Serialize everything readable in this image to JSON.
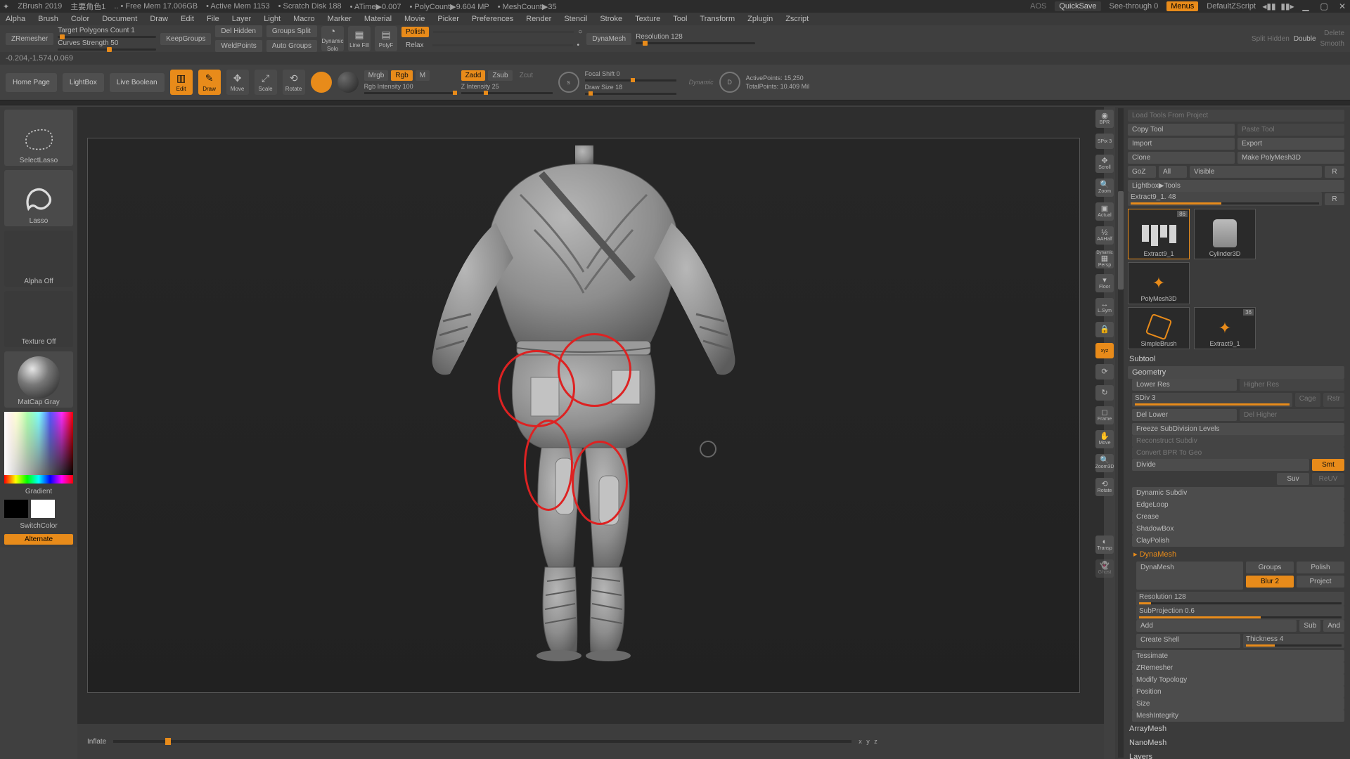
{
  "title_bar": {
    "app": "ZBrush 2019",
    "doc": "主要角色1",
    "free_mem": ".. • Free Mem 17.006GB",
    "active_mem": "• Active Mem 1153",
    "scratch": "• Scratch Disk 188",
    "atime": "• ATime▶0.007",
    "polycount": "• PolyCount▶9.604 MP",
    "meshcount": "• MeshCount▶35",
    "quicksave": "QuickSave",
    "seethrough": "See-through  0",
    "menus": "Menus",
    "defscript": "DefaultZScript",
    "aos": "AOS"
  },
  "menu": [
    "Alpha",
    "Brush",
    "Color",
    "Document",
    "Draw",
    "Edit",
    "File",
    "Layer",
    "Light",
    "Macro",
    "Marker",
    "Material",
    "Movie",
    "Picker",
    "Preferences",
    "Render",
    "Stencil",
    "Stroke",
    "Texture",
    "Tool",
    "Transform",
    "Zplugin",
    "Zscript"
  ],
  "secondary": {
    "zremesher": "ZRemesher",
    "tgt_poly": "Target Polygons Count 1",
    "curve_str": "Curves Strength 50",
    "keepgroups": "KeepGroups",
    "delhidden": "Del Hidden",
    "groupssplit": "Groups Split",
    "weldpoints": "WeldPoints",
    "autogroups": "Auto Groups",
    "dynamic": "Dynamic",
    "solo": "Solo",
    "linefill": "Line Fill",
    "polyf": "PolyF",
    "polish": "Polish",
    "relax": "Relax",
    "dynamesh": "DynaMesh",
    "resolution": "Resolution 128",
    "splithidden": "Split Hidden",
    "double": "Double",
    "delete": "Delete",
    "smooth": "Smooth"
  },
  "coord": "-0.204,-1.574,0.069",
  "ribbon": {
    "home": "Home Page",
    "lightbox": "LightBox",
    "livebool": "Live Boolean",
    "edit": "Edit",
    "draw": "Draw",
    "move": "Move",
    "scale": "Scale",
    "rotate": "Rotate",
    "mrgb": "Mrgb",
    "rgb": "Rgb",
    "m": "M",
    "rgb_int": "Rgb Intensity 100",
    "zadd": "Zadd",
    "zsub": "Zsub",
    "zcut": "Zcut",
    "z_int": "Z Intensity 25",
    "focal": "Focal Shift 0",
    "drawsize": "Draw Size 18",
    "dynamic_l": "Dynamic",
    "active_pts": "ActivePoints: 15,250",
    "total_pts": "TotalPoints: 10.409 Mil"
  },
  "left": {
    "selectlasso": "SelectLasso",
    "lasso": "Lasso",
    "alpha": "Alpha Off",
    "texture": "Texture Off",
    "matcap": "MatCap Gray",
    "gradient": "Gradient",
    "switchcolor": "SwitchColor",
    "alternate": "Alternate"
  },
  "bottom": {
    "inflate": "Inflate",
    "xyz": "x y z"
  },
  "right_strip": {
    "bpr": "BPR",
    "spix": "SPix 3",
    "scroll": "Scroll",
    "zoom": "Zoom",
    "actual": "Actual",
    "aahalf": "AAHalf",
    "persp": "Persp",
    "floor": "Floor",
    "lsym": "L.Sym",
    "lock": "🔒",
    "xyz": "xyz",
    "axis1": "⟳",
    "axis2": "↻",
    "frame": "Frame",
    "move": "Move",
    "zoom3d": "Zoom3D",
    "rotate": "Rotate",
    "transp": "Transp",
    "ghost": "Ghost",
    "dynamic": "Dynamic"
  },
  "right_panel": {
    "load_tools": "Load Tools From Project",
    "copytool": "Copy Tool",
    "pastetool": "Paste Tool",
    "import": "Import",
    "export": "Export",
    "clone": "Clone",
    "makepoly": "Make PolyMesh3D",
    "goz": "GoZ",
    "all": "All",
    "visible": "Visible",
    "r": "R",
    "lightbox_tools": "Lightbox▶Tools",
    "extract_slider": "Extract9_1. 48",
    "thumbs": {
      "t1": "Extract9_1",
      "t1b": "86",
      "t2": "Cylinder3D",
      "t3": "PolyMesh3D",
      "t4": "SimpleBrush",
      "t5": "Extract9_1",
      "t5b": "36"
    },
    "subtool": "Subtool",
    "geometry": "Geometry",
    "lowerres": "Lower Res",
    "higherres": "Higher Res",
    "sdiv": "SDiv 3",
    "cage": "Cage",
    "rstr": "Rstr",
    "dellower": "Del Lower",
    "delhigher": "Del Higher",
    "freeze": "Freeze SubDivision Levels",
    "reconstruct": "Reconstruct Subdiv",
    "convertbpr": "Convert BPR To Geo",
    "divide": "Divide",
    "smt": "Smt",
    "suv": "Suv",
    "reuv": "ReUV",
    "dynsubdiv": "Dynamic Subdiv",
    "edgeloop": "EdgeLoop",
    "crease": "Crease",
    "shadowbox": "ShadowBox",
    "claypolish": "ClayPolish",
    "dynamesh": "DynaMesh",
    "dynamesh_btn": "DynaMesh",
    "groups": "Groups",
    "polish": "Polish",
    "blur": "Blur 2",
    "project": "Project",
    "res": "Resolution 128",
    "subproj": "SubProjection 0.6",
    "add": "Add",
    "sub": "Sub",
    "and": "And",
    "createshell": "Create Shell",
    "thickness": "Thickness 4",
    "tessimate": "Tessimate",
    "zremesher": "ZRemesher",
    "modtopo": "Modify Topology",
    "position": "Position",
    "size": "Size",
    "meshint": "MeshIntegrity",
    "arraymesh": "ArrayMesh",
    "nanomesh": "NanoMesh",
    "layers": "Layers"
  }
}
